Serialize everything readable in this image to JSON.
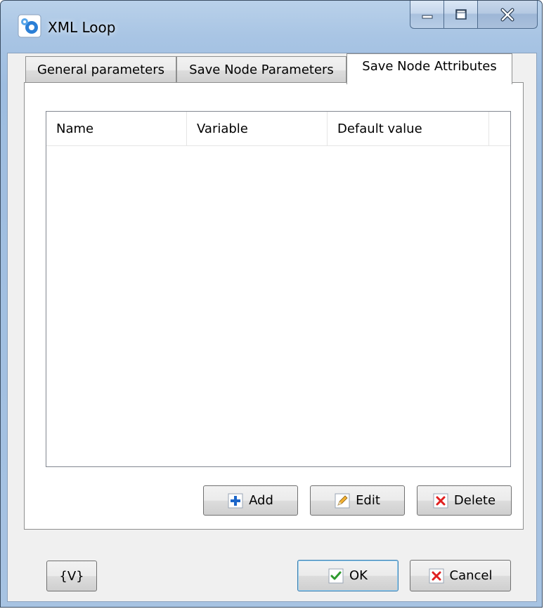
{
  "window": {
    "title": "XML Loop",
    "app_icon": "gear-arrow-icon",
    "caption_buttons": [
      "minimize-icon",
      "maximize-icon",
      "close-icon"
    ]
  },
  "tabs": [
    {
      "label": "General parameters",
      "active": false
    },
    {
      "label": "Save Node Parameters",
      "active": false
    },
    {
      "label": "Save Node Attributes",
      "active": true
    }
  ],
  "listview": {
    "columns": [
      "Name",
      "Variable",
      "Default value",
      ""
    ],
    "rows": []
  },
  "panel_buttons": {
    "add": {
      "label": "Add",
      "icon": "plus-icon"
    },
    "edit": {
      "label": "Edit",
      "icon": "pencil-icon"
    },
    "delete": {
      "label": "Delete",
      "icon": "red-x-icon"
    }
  },
  "footer": {
    "variables_label": "{V}",
    "ok_label": "OK",
    "ok_icon": "checkmark-icon",
    "cancel_label": "Cancel",
    "cancel_icon": "red-x-icon"
  },
  "colors": {
    "frame": "#a9c5e4",
    "client": "#f0f0f0",
    "plus_blue": "#1c66c9",
    "delete_red": "#e02020",
    "check_green": "#2e9a2e"
  }
}
